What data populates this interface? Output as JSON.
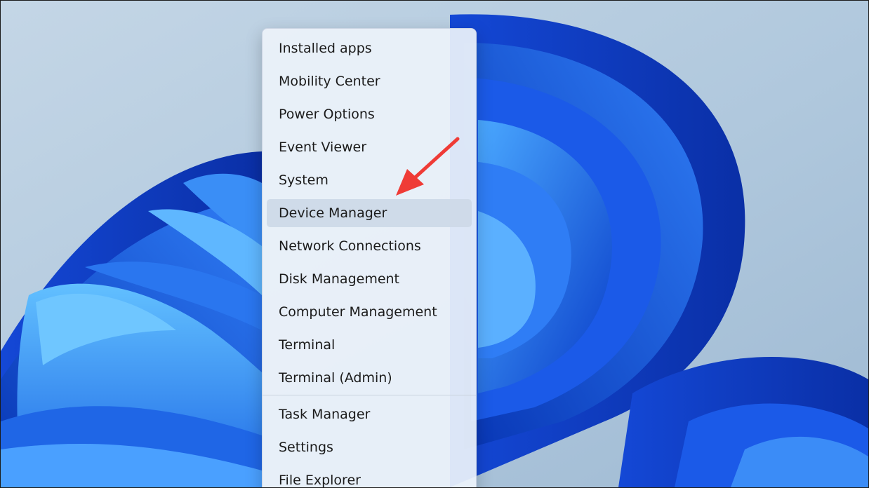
{
  "desktop": {
    "wallpaper": "windows-11-bloom-wallpaper"
  },
  "context_menu": {
    "items": [
      {
        "label": "Installed apps"
      },
      {
        "label": "Mobility Center"
      },
      {
        "label": "Power Options"
      },
      {
        "label": "Event Viewer"
      },
      {
        "label": "System"
      },
      {
        "label": "Device Manager",
        "highlighted": true
      },
      {
        "label": "Network Connections"
      },
      {
        "label": "Disk Management"
      },
      {
        "label": "Computer Management"
      },
      {
        "label": "Terminal"
      },
      {
        "label": "Terminal (Admin)"
      },
      {
        "label": "Task Manager"
      },
      {
        "label": "Settings"
      },
      {
        "label": "File Explorer"
      }
    ]
  },
  "annotation": {
    "type": "arrow",
    "color": "#ef3b36",
    "points_to": "Device Manager"
  },
  "colors": {
    "menu_background": "#ecf2fa",
    "menu_hover": "#cdd9e8",
    "text": "#1b1b1b",
    "wallpaper_sky": "#b7cde0",
    "wallpaper_blue": "#1f5fe8"
  }
}
